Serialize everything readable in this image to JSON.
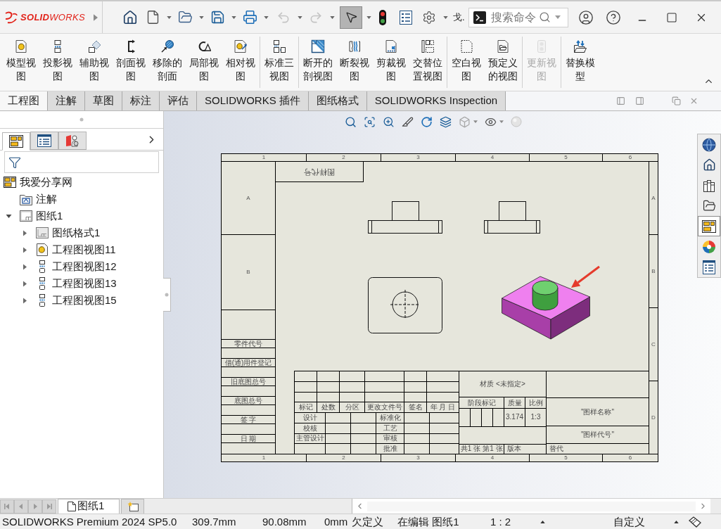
{
  "title_bar": {
    "logo": "**SOLID**WORKS",
    "quick_access": [
      {
        "dropdown": false,
        "disabled": false,
        "pressed": false
      },
      {
        "dropdown": true,
        "disabled": false,
        "pressed": false
      },
      {
        "dropdown": true,
        "disabled": false,
        "pressed": false
      },
      {
        "dropdown": true,
        "disabled": false,
        "pressed": false
      },
      {
        "dropdown": true,
        "disabled": false,
        "pressed": false
      },
      {
        "dropdown": true,
        "disabled": true,
        "pressed": false
      },
      {
        "dropdown": true,
        "disabled": true,
        "pressed": false
      },
      {
        "dropdown": true,
        "disabled": false,
        "pressed": true
      },
      {
        "dropdown": false,
        "disabled": false,
        "pressed": false
      },
      {
        "dropdown": false,
        "disabled": false,
        "pressed": false
      },
      {
        "dropdown": true,
        "disabled": false,
        "pressed": false
      }
    ],
    "title_fragment": "戈.",
    "search": {
      "placeholder": "搜索命令"
    }
  },
  "ribbon": {
    "groups": [
      [
        {
          "label": "模型视图",
          "disabled": false
        },
        {
          "label": "投影视图",
          "disabled": false
        },
        {
          "label": "辅助视图",
          "disabled": false
        },
        {
          "label": "剖面视图",
          "disabled": false
        },
        {
          "label": "移除的剖面",
          "disabled": false
        },
        {
          "label": "局部视图",
          "disabled": false
        },
        {
          "label": "相对视图",
          "disabled": false
        }
      ],
      [
        {
          "label": "标准三视图",
          "disabled": false
        }
      ],
      [
        {
          "label": "断开的剖视图",
          "disabled": false
        },
        {
          "label": "断裂视图",
          "disabled": false
        },
        {
          "label": "剪裁视图",
          "disabled": false
        },
        {
          "label": "交替位置视图",
          "disabled": false
        }
      ],
      [
        {
          "label": "空白视图",
          "disabled": false
        },
        {
          "label": "预定义的视图",
          "disabled": false
        }
      ],
      [
        {
          "label": "更新视图",
          "disabled": true
        }
      ],
      [
        {
          "label": "替换模型",
          "disabled": false
        }
      ]
    ]
  },
  "tabs": [
    {
      "label": "工程图",
      "selected": true
    },
    {
      "label": "注解",
      "selected": false
    },
    {
      "label": "草图",
      "selected": false
    },
    {
      "label": "标注",
      "selected": false
    },
    {
      "label": "评估",
      "selected": false
    },
    {
      "label": "SOLIDWORKS 插件",
      "selected": false
    },
    {
      "label": "图纸格式",
      "selected": false
    },
    {
      "label": "SOLIDWORKS Inspection",
      "selected": false
    }
  ],
  "feature_manager": {
    "panel_tabs": [
      {
        "selected": true
      },
      {
        "selected": false
      },
      {
        "selected": false
      }
    ],
    "tree": [
      {
        "label": "我爱分享网",
        "kind": "drawing",
        "children": [
          {
            "label": "注解",
            "kind": "annotations"
          },
          {
            "label": "图纸1",
            "kind": "sheet",
            "expanded": true,
            "children": [
              {
                "label": "图纸格式1",
                "kind": "sheet_format",
                "expanded": false
              },
              {
                "label": "工程图视图11",
                "kind": "model_view",
                "expanded": false
              },
              {
                "label": "工程图视图12",
                "kind": "projected_view",
                "expanded": false
              },
              {
                "label": "工程图视图13",
                "kind": "projected_view",
                "expanded": false
              },
              {
                "label": "工程图视图15",
                "kind": "projected_view",
                "expanded": false
              }
            ]
          }
        ]
      }
    ]
  },
  "drawing_sheet": {
    "top_zones": [
      "1",
      "2",
      "3",
      "4",
      "5",
      "6"
    ],
    "left_zones": [
      "A",
      "B"
    ],
    "right_zones": [
      "A",
      "B",
      "C",
      "D"
    ],
    "mirrored_label": "图样代号",
    "left_stamps": [
      "零件代号",
      "借(通)用件登记",
      "旧底图总号",
      "底图总号",
      "签 字",
      "日 期"
    ],
    "title_block": {
      "material": "材质 <未指定>",
      "revision_columns": [
        "标记",
        "处数",
        "分区",
        "更改文件号",
        "签名",
        "年 月 日"
      ],
      "approvals": [
        {
          "role": "设计",
          "check": "标准化"
        },
        {
          "role": "校核",
          "check": "工艺"
        },
        {
          "role": "主管设计",
          "check": "审核"
        },
        {
          "check": "批准"
        }
      ],
      "stage_label": "阶段标记",
      "mass_label": "质量",
      "scale_label": "比例",
      "mass": "3.174",
      "scale": "1:3",
      "drawing_name": "\"图样名称\"",
      "drawing_number": "\"图样代号\"",
      "sheet_count": "共1 张",
      "sheet_index": "第1 张",
      "version_label": "版本",
      "replaces_label": "替代"
    },
    "bottom_zones": [
      "1",
      "2",
      "3",
      "4",
      "5",
      "6"
    ]
  },
  "task_pane": [
    {
      "selected": false
    },
    {
      "selected": false
    },
    {
      "selected": false
    },
    {
      "selected": false
    },
    {
      "selected": true
    },
    {
      "selected": false
    },
    {
      "selected": false
    }
  ],
  "sheet_tabs": [
    {
      "label": "图纸1",
      "selected": true
    }
  ],
  "status_bar": {
    "product": "SOLIDWORKS Premium 2024 SP5.0",
    "x": "309.7mm",
    "y": "90.08mm",
    "z": "0mm",
    "sketch_status": "欠定义",
    "mode": "在编辑 图纸1",
    "scale": "1 : 2",
    "units": "自定义"
  }
}
